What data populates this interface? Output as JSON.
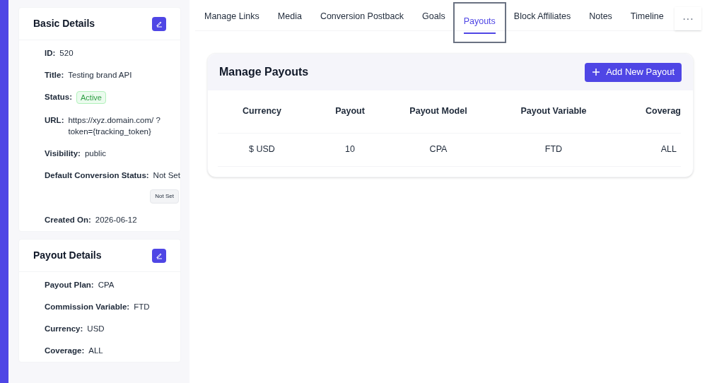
{
  "cards": [
    {
      "title": "Basic Details",
      "fields": [
        {
          "label": "ID:",
          "value": "520"
        },
        {
          "label": "Title:",
          "value": "Testing brand API"
        },
        {
          "label": "Status:",
          "value": "Active",
          "kind": "badge"
        },
        {
          "label": "URL:",
          "value": "https://xyz.domain.com/ ?token={tracking_token}"
        },
        {
          "label": "Visibility:",
          "value": "public"
        },
        {
          "label": "Default Conversion Status:",
          "value": "Not Set",
          "tag": "Not Set"
        },
        {
          "label": "Created On:",
          "value": "2026-06-12"
        }
      ]
    },
    {
      "title": "Payout Details",
      "fields": [
        {
          "label": "Payout Plan:",
          "value": "CPA"
        },
        {
          "label": "Commission Variable:",
          "value": "FTD"
        },
        {
          "label": "Currency:",
          "value": "USD"
        },
        {
          "label": "Coverage:",
          "value": "ALL"
        }
      ]
    }
  ],
  "tabs": [
    {
      "label": "Manage Links",
      "selected": false
    },
    {
      "label": "Media",
      "selected": false
    },
    {
      "label": "Conversion Postback",
      "selected": false
    },
    {
      "label": "Goals",
      "selected": false
    },
    {
      "label": "Payouts",
      "selected": true
    },
    {
      "label": "Block Affiliates",
      "selected": false
    },
    {
      "label": "Notes",
      "selected": false
    },
    {
      "label": "Timeline",
      "selected": false
    }
  ],
  "more_button": "···",
  "panel": {
    "title": "Manage Payouts",
    "add_button": "Add New Payout",
    "table": {
      "columns": [
        "Currency",
        "Payout",
        "Payout Model",
        "Payout Variable",
        "Coverag"
      ],
      "rows": [
        [
          "$ USD",
          "10",
          "CPA",
          "FTD",
          "ALL"
        ]
      ]
    }
  }
}
